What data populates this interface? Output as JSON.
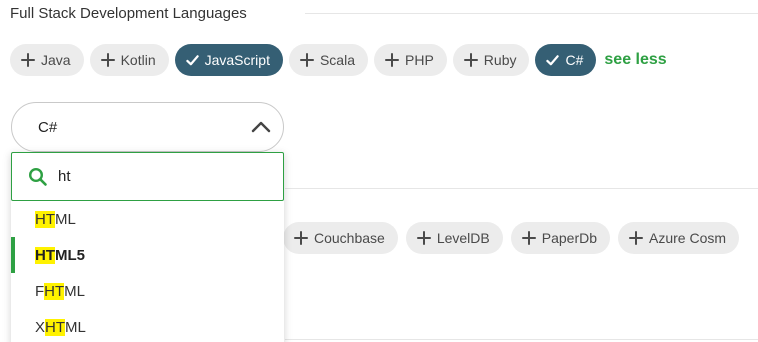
{
  "section": {
    "title": "Full Stack Development Languages"
  },
  "languages": [
    {
      "label": "Java",
      "selected": false
    },
    {
      "label": "Kotlin",
      "selected": false
    },
    {
      "label": "JavaScript",
      "selected": true
    },
    {
      "label": "Scala",
      "selected": false
    },
    {
      "label": "PHP",
      "selected": false
    },
    {
      "label": "Ruby",
      "selected": false
    },
    {
      "label": "C#",
      "selected": true
    }
  ],
  "see_less_label": "see less",
  "select": {
    "value": "C#"
  },
  "search": {
    "value": "ht",
    "placeholder": ""
  },
  "options": [
    {
      "pre": "",
      "match": "HT",
      "post": "ML",
      "active": false
    },
    {
      "pre": "",
      "match": "HT",
      "post": "ML5",
      "active": true
    },
    {
      "pre": "F",
      "match": "HT",
      "post": "ML",
      "active": false
    },
    {
      "pre": "X",
      "match": "HT",
      "post": "ML",
      "active": false
    }
  ],
  "databases": [
    {
      "label": "Couchbase"
    },
    {
      "label": "LevelDB"
    },
    {
      "label": "PaperDb"
    },
    {
      "label": "Azure Cosm"
    }
  ],
  "colors": {
    "accent": "#2ea043",
    "chip_selected": "#355f74",
    "chip": "#ececec",
    "highlight": "#fff200"
  }
}
